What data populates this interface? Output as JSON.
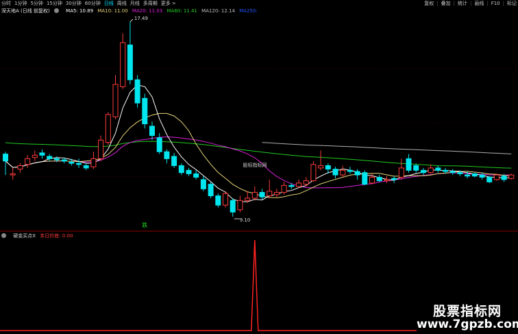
{
  "toolbar": {
    "periods": [
      "分时",
      "1分钟",
      "5分钟",
      "15分钟",
      "30分钟",
      "60分钟",
      "日线",
      "周线",
      "月线",
      "多周期",
      "更多 >"
    ],
    "active_period": "日线",
    "tools": [
      "复权",
      "叠加",
      "统计",
      "画线",
      "F10",
      "标记"
    ]
  },
  "legend": {
    "stock": "深天地A (日线 前复权)",
    "ma5_label": "MA5: 10.89",
    "ma10_label": "MA10: 11.00",
    "ma20_label": "MA20: 11.03",
    "ma60_label": "MA60: 11.41",
    "ma120_label": "MA120: 12.14",
    "ma250_label": "MA250: "
  },
  "indicator": {
    "name": "硬金买点X",
    "today_label": "本日抄底: 0.00"
  },
  "annotations": {
    "high_label": "17.49",
    "low_label": "9.10",
    "center_text": "股标指标网",
    "signal_glyph": "跌"
  },
  "watermark": {
    "title": "股票指标网",
    "url": "www.7gpzb.com"
  },
  "colors": {
    "up": "#ff3b3b",
    "down": "#00e5ee",
    "ma5": "#ffffff",
    "ma10": "#e8d67a",
    "ma20": "#dd22dd",
    "ma60": "#22cc22",
    "ma120": "#b0b0b0",
    "ma250": "#2255ff",
    "indicator": "#ff2222",
    "grid": "#8b0000"
  },
  "chart_data": {
    "type": "candlestick",
    "price_range": [
      9.1,
      17.49
    ],
    "ohlc": [
      [
        11.8,
        11.5,
        11.9,
        10.9
      ],
      [
        10.9,
        10.95,
        11.2,
        10.7
      ],
      [
        11.15,
        11.3,
        11.4,
        11.0
      ],
      [
        11.35,
        11.6,
        11.75,
        11.2
      ],
      [
        11.65,
        11.75,
        11.95,
        11.5
      ],
      [
        11.85,
        11.75,
        12.0,
        11.6
      ],
      [
        11.7,
        11.6,
        11.8,
        11.5
      ],
      [
        11.6,
        11.55,
        11.7,
        11.45
      ],
      [
        11.55,
        11.5,
        11.65,
        11.4
      ],
      [
        11.45,
        11.4,
        11.6,
        11.3
      ],
      [
        11.4,
        11.35,
        11.6,
        11.2
      ],
      [
        11.3,
        11.2,
        11.4,
        11.1
      ],
      [
        11.25,
        11.6,
        11.9,
        11.15
      ],
      [
        11.6,
        12.4,
        12.6,
        11.5
      ],
      [
        12.3,
        13.5,
        13.6,
        12.2
      ],
      [
        13.4,
        14.8,
        15.2,
        13.3
      ],
      [
        14.7,
        16.6,
        17.0,
        14.6
      ],
      [
        16.5,
        15.0,
        17.49,
        14.8
      ],
      [
        15.0,
        14.0,
        15.2,
        13.8
      ],
      [
        14.2,
        13.1,
        14.4,
        12.9
      ],
      [
        13.0,
        12.6,
        13.2,
        12.4
      ],
      [
        12.5,
        11.9,
        12.7,
        11.8
      ],
      [
        11.9,
        11.6,
        12.0,
        11.4
      ],
      [
        11.7,
        11.3,
        11.85,
        11.2
      ],
      [
        11.3,
        11.0,
        11.4,
        10.9
      ],
      [
        11.1,
        10.95,
        11.2,
        10.85
      ],
      [
        10.95,
        10.8,
        11.1,
        10.7
      ],
      [
        10.7,
        10.3,
        10.85,
        10.2
      ],
      [
        10.5,
        10.0,
        10.6,
        9.9
      ],
      [
        10.0,
        9.6,
        10.1,
        9.5
      ],
      [
        9.6,
        10.1,
        10.2,
        9.5
      ],
      [
        9.8,
        9.3,
        9.9,
        9.1
      ],
      [
        9.4,
        9.8,
        10.0,
        9.3
      ],
      [
        9.8,
        9.9,
        10.2,
        9.7
      ],
      [
        9.9,
        10.15,
        10.4,
        9.8
      ],
      [
        10.15,
        9.95,
        10.3,
        9.85
      ],
      [
        10.0,
        10.2,
        10.7,
        9.9
      ],
      [
        10.05,
        10.15,
        10.3,
        9.95
      ],
      [
        10.15,
        10.45,
        10.6,
        10.05
      ],
      [
        10.45,
        10.4,
        10.55,
        10.3
      ],
      [
        10.4,
        10.55,
        10.7,
        10.35
      ],
      [
        10.5,
        10.65,
        10.8,
        10.4
      ],
      [
        10.65,
        11.35,
        11.5,
        10.6
      ],
      [
        11.2,
        11.3,
        11.95,
        11.1
      ],
      [
        11.3,
        11.15,
        11.4,
        10.95
      ],
      [
        11.15,
        10.9,
        11.25,
        10.75
      ],
      [
        10.9,
        11.1,
        11.3,
        10.8
      ],
      [
        11.1,
        11.05,
        11.25,
        10.95
      ],
      [
        11.05,
        10.9,
        11.15,
        10.7
      ],
      [
        11.0,
        10.5,
        11.1,
        10.45
      ],
      [
        10.55,
        10.8,
        10.95,
        10.5
      ],
      [
        10.8,
        10.65,
        10.9,
        10.6
      ],
      [
        10.65,
        10.7,
        10.85,
        10.55
      ],
      [
        10.75,
        10.7,
        10.85,
        10.55
      ],
      [
        10.8,
        11.2,
        11.6,
        10.7
      ],
      [
        11.6,
        11.1,
        11.8,
        11.0
      ],
      [
        11.3,
        11.1,
        11.4,
        11.0
      ],
      [
        11.1,
        11.0,
        11.2,
        10.9
      ],
      [
        11.0,
        11.2,
        11.35,
        10.95
      ],
      [
        11.2,
        11.1,
        11.3,
        11.0
      ],
      [
        11.1,
        11.05,
        11.2,
        10.95
      ],
      [
        11.05,
        11.0,
        11.15,
        10.9
      ],
      [
        11.0,
        10.95,
        11.1,
        10.85
      ],
      [
        10.9,
        10.85,
        11.05,
        10.75
      ],
      [
        10.95,
        10.85,
        11.0,
        10.8
      ],
      [
        10.9,
        10.8,
        11.0,
        10.7
      ],
      [
        10.8,
        10.6,
        10.85,
        10.55
      ],
      [
        10.7,
        10.9,
        10.95,
        10.65
      ],
      [
        10.85,
        10.7,
        10.95,
        10.6
      ],
      [
        10.75,
        10.9,
        10.95,
        10.7
      ]
    ],
    "indicator_values": [
      0,
      0,
      0,
      0,
      0,
      0,
      0,
      0,
      0,
      0,
      0,
      0,
      0,
      0,
      0,
      0,
      0,
      0,
      0,
      0,
      0,
      0,
      0,
      0,
      0,
      0,
      0,
      0,
      0,
      0,
      0,
      0,
      0,
      0,
      1,
      0,
      0,
      0,
      0,
      0,
      0,
      0,
      0,
      0,
      0,
      0,
      0,
      0,
      0,
      0,
      0,
      0,
      0,
      0,
      0,
      0,
      0,
      0,
      0,
      0,
      0,
      0,
      0,
      0,
      0,
      0,
      0,
      0,
      0,
      0
    ]
  }
}
